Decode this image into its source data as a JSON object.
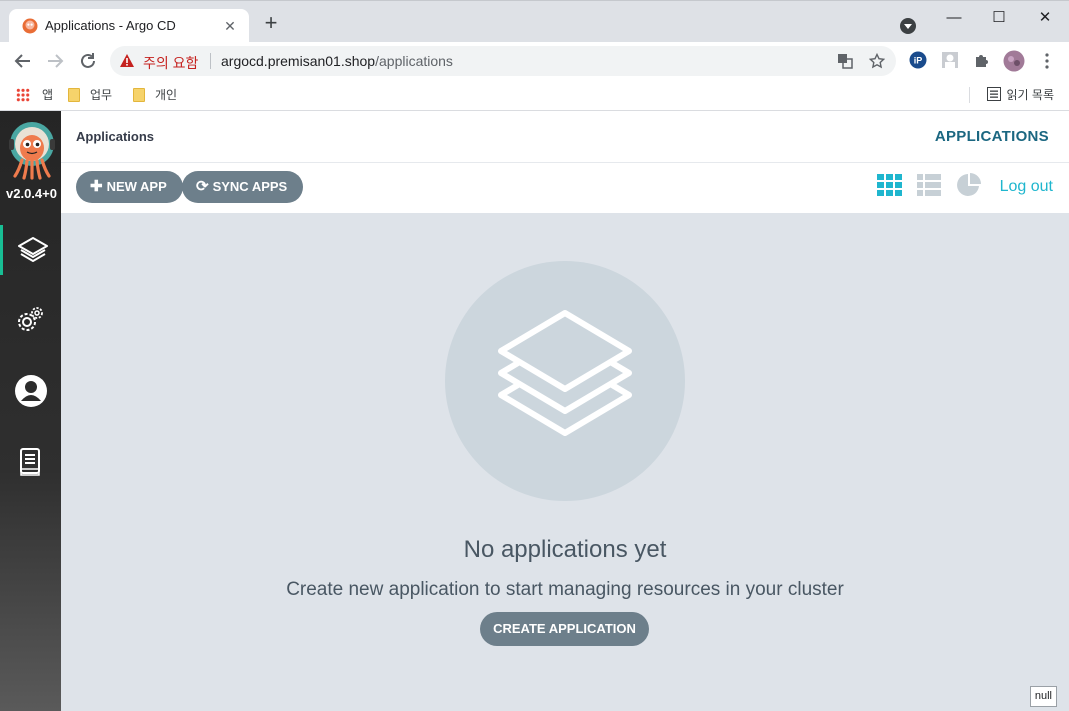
{
  "browser": {
    "tab_title": "Applications - Argo CD",
    "tab_close": "✕",
    "new_tab": "+",
    "window_controls": {
      "minimize": "—",
      "maximize": "☐",
      "close": "✕"
    },
    "security_warning": "주의 요함",
    "url_host": "argocd.premisan01.shop",
    "url_path": "/applications",
    "bookmarks": [
      {
        "label": "앱",
        "icon": "apps-grid-icon"
      },
      {
        "label": "업무",
        "icon": "folder-icon"
      },
      {
        "label": "개인",
        "icon": "folder-icon"
      }
    ],
    "reading_list": "읽기 목록"
  },
  "sidebar": {
    "version": "v2.0.4+0",
    "items": [
      {
        "name": "applications",
        "icon": "layers-icon",
        "active": true
      },
      {
        "name": "settings",
        "icon": "gears-icon",
        "active": false
      },
      {
        "name": "user-info",
        "icon": "user-icon",
        "active": false
      },
      {
        "name": "documentation",
        "icon": "docs-icon",
        "active": false
      }
    ]
  },
  "header": {
    "breadcrumb": "Applications",
    "title": "APPLICATIONS"
  },
  "actions": {
    "new_app": "NEW APP",
    "sync_apps": "SYNC APPS",
    "logout": "Log out"
  },
  "empty_state": {
    "title": "No applications yet",
    "subtitle": "Create new application to start managing resources in your cluster",
    "button": "CREATE APPLICATION"
  },
  "footer_badge": "null",
  "colors": {
    "accent": "#1fb6ce",
    "title": "#1b6781",
    "button": "#6d7f8b",
    "sidebar_active": "#18be94",
    "background": "#dee3e9"
  }
}
